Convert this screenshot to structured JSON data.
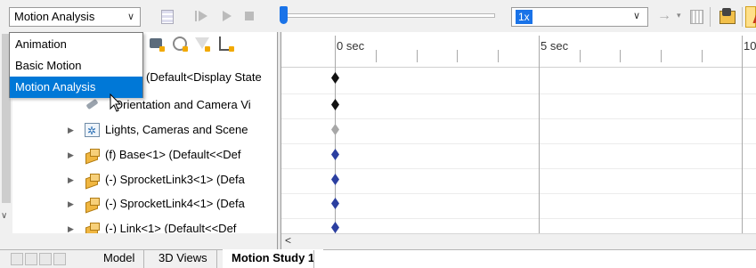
{
  "toolbar": {
    "study_type": "Motion Analysis",
    "playback_speed": "1x"
  },
  "study_menu": {
    "items": [
      {
        "label": "Animation"
      },
      {
        "label": "Basic Motion"
      },
      {
        "label": "Motion Analysis",
        "selected": true
      }
    ]
  },
  "tree": {
    "rows": [
      {
        "label": "(Default<Display State",
        "icon": "assembly-icon",
        "key": "black"
      },
      {
        "label": "Orientation and Camera Vi",
        "icon": "camera-icon",
        "key": "black"
      },
      {
        "label": "Lights, Cameras and Scene",
        "icon": "lights-icon",
        "key": "grey"
      },
      {
        "label": "(f) Base<1> (Default<<Def",
        "icon": "part-icon",
        "key": "blue"
      },
      {
        "label": "(-) SprocketLink3<1> (Defa",
        "icon": "part-icon",
        "key": "blue"
      },
      {
        "label": "(-) SprocketLink4<1> (Defa",
        "icon": "part-icon",
        "key": "blue"
      },
      {
        "label": "(-) Link<1> (Default<<Def",
        "icon": "part-icon",
        "key": "blue"
      }
    ]
  },
  "timeline": {
    "labels": [
      "0 sec",
      "5 sec",
      "10"
    ],
    "slider_position": 0
  },
  "tabs": [
    {
      "label": "Model"
    },
    {
      "label": "3D Views"
    },
    {
      "label": "Motion Study 1",
      "active": true
    }
  ],
  "colors": {
    "selection": "#0078d7",
    "slider": "#1a73e8",
    "key_black": "#111111",
    "key_grey": "#a7a7a7",
    "key_blue": "#2b3fa0"
  }
}
